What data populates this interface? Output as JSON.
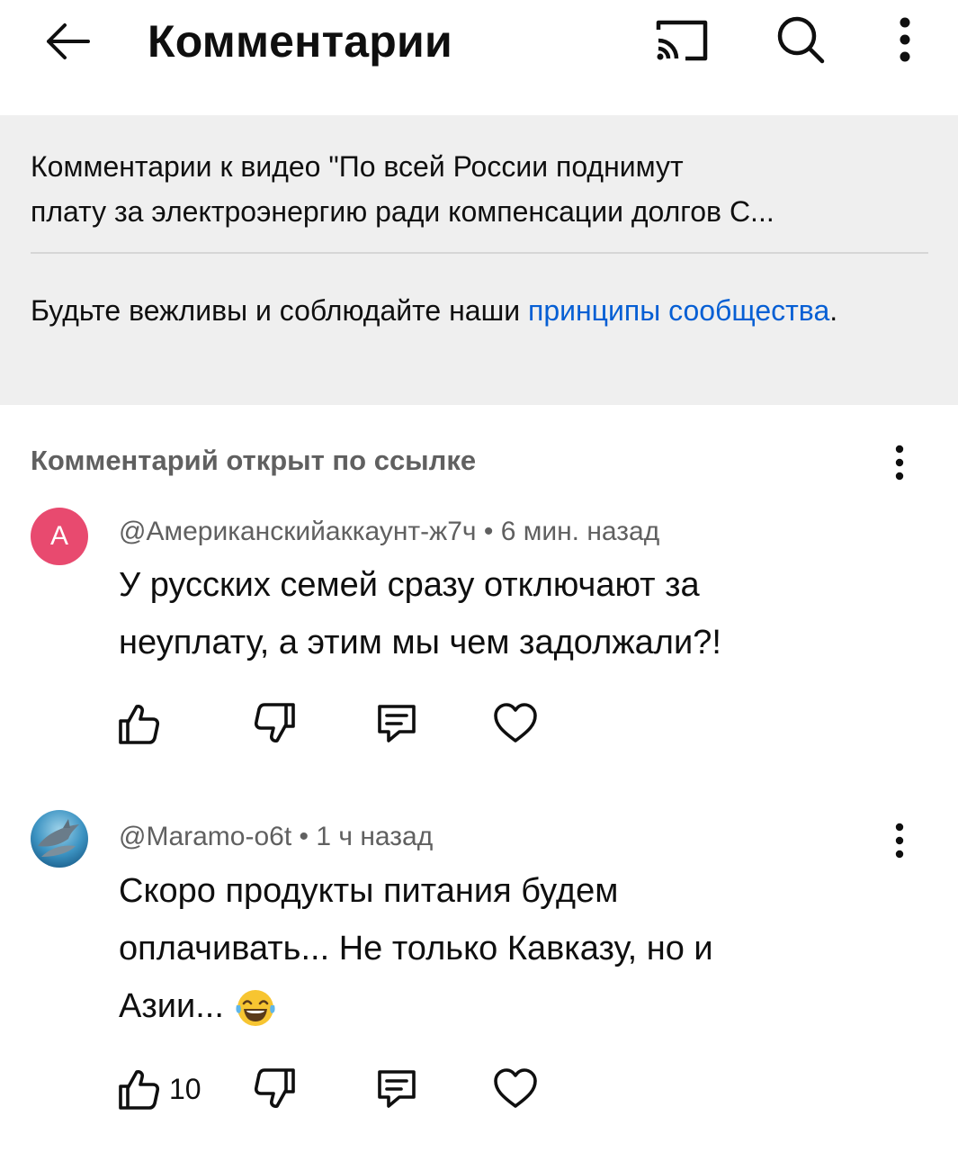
{
  "header": {
    "title": "Комментарии"
  },
  "info": {
    "video_caption_line1": "Комментарии к видео \"По всей России поднимут",
    "video_caption_line2": "плату за электроэнергию ради компенсации долгов С...",
    "rules_prefix": "Будьте вежливы и соблюдайте наши ",
    "rules_link": "принципы сообщества",
    "rules_suffix": "."
  },
  "linked_section": {
    "label": "Комментарий открыт по ссылке"
  },
  "comments": [
    {
      "avatar_letter": "A",
      "author": "@Американскийаккаунт-ж7ч",
      "separator": " • ",
      "time": "6 мин. назад",
      "text_line1": "У русских семей сразу отключают за",
      "text_line2": "неуплату, а этим мы чем задолжали?!",
      "likes": ""
    },
    {
      "avatar_icon": "dolphin-avatar",
      "author": "@Maramo-o6t",
      "separator": " • ",
      "time": "1 ч назад",
      "text_line1": "Скоро продукты питания будем",
      "text_line2": "оплачивать... Не только Кавказу, но и",
      "text_line3": "Азии...",
      "emoji": "laughing-tears-emoji",
      "likes": "10"
    }
  ],
  "icons": {
    "back": "arrow-left-icon",
    "cast": "cast-icon",
    "search": "search-icon",
    "more": "more-vert-icon",
    "like": "thumb-up-icon",
    "dislike": "thumb-down-icon",
    "reply": "reply-icon",
    "heart": "heart-icon"
  },
  "colors": {
    "link": "#065fd4",
    "panel_bg": "#efefef",
    "avatar_a": "#e84a6f",
    "secondary_text": "#606060"
  }
}
